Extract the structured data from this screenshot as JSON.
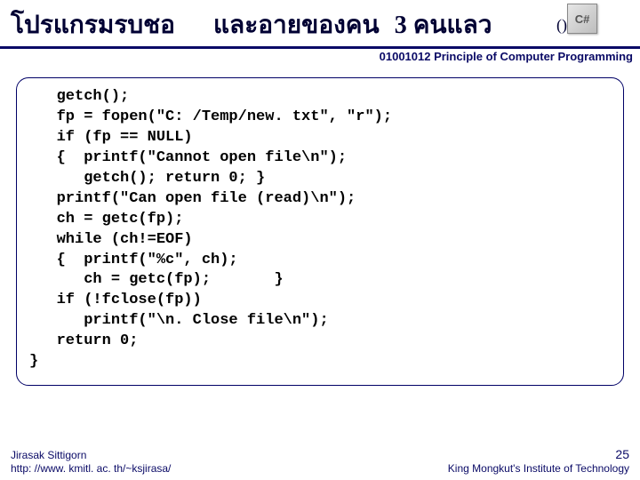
{
  "header": {
    "title_seg1": "โปรแกรมรบชอ",
    "title_seg2": "และอายของคน",
    "title_seg3": "3 คนแลว",
    "paren": "()",
    "logo_text": "C#",
    "subtitle": "01001012 Principle of Computer Programming"
  },
  "code": "   getch();\n   fp = fopen(\"C: /Temp/new. txt\", \"r\");\n   if (fp == NULL)\n   {  printf(\"Cannot open file\\n\");\n      getch(); return 0; }\n   printf(\"Can open file (read)\\n\");\n   ch = getc(fp);\n   while (ch!=EOF)\n   {  printf(\"%c\", ch);\n      ch = getc(fp);       }\n   if (!fclose(fp))\n      printf(\"\\n. Close file\\n\");\n   return 0;\n}",
  "footer": {
    "author": "Jirasak Sittigorn",
    "url": "http: //www. kmitl. ac. th/~ksjirasa/",
    "slide_number": "25",
    "institution": "King Mongkut's Institute of Technology"
  }
}
